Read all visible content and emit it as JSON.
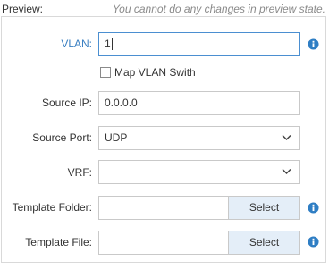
{
  "header": {
    "title": "Preview:",
    "notice": "You cannot do any changes in preview state."
  },
  "form": {
    "vlan": {
      "label": "VLAN:",
      "value": "1"
    },
    "map_vlan": {
      "label": "Map VLAN Swith",
      "checked": false
    },
    "source_ip": {
      "label": "Source IP:",
      "value": "0.0.0.0"
    },
    "source_port": {
      "label": "Source Port:",
      "value": "UDP"
    },
    "vrf": {
      "label": "VRF:",
      "value": ""
    },
    "template_folder": {
      "label": "Template Folder:",
      "value": "",
      "button": "Select"
    },
    "template_file": {
      "label": "Template File:",
      "value": "",
      "button": "Select"
    }
  },
  "icons": {
    "info": "info-icon",
    "dropdown": "chevron-down-icon"
  },
  "colors": {
    "label_accent": "#3a7fc1",
    "info_icon": "#2f7ec4",
    "select_button_bg": "#e4eef8",
    "focus_border": "#4b8fd1"
  }
}
